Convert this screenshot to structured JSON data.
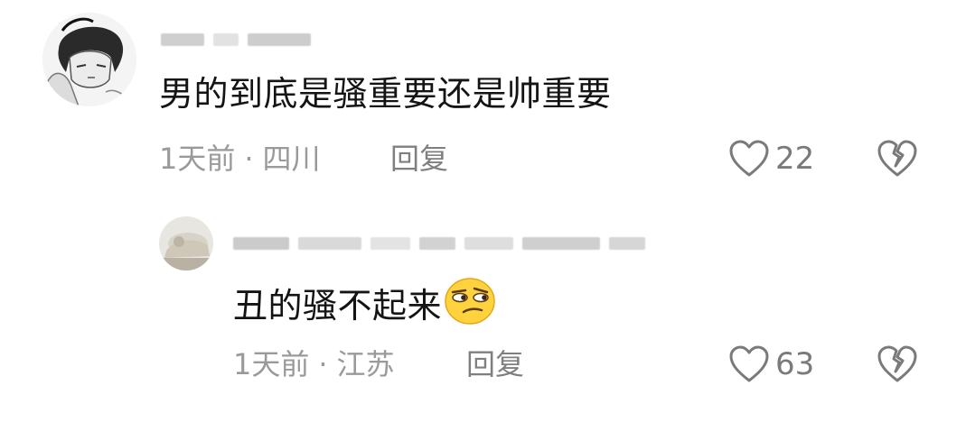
{
  "comments": [
    {
      "username": "",
      "text": "男的到底是骚重要还是帅重要",
      "time": "1天前",
      "separator": "·",
      "location": "四川",
      "reply_label": "回复",
      "likes": "22",
      "avatar_icon": "manga-character-avatar-icon"
    },
    {
      "username": "",
      "text": "丑的骚不起来",
      "emoji": "smirk-emoji-icon",
      "time": "1天前",
      "separator": "·",
      "location": "江苏",
      "reply_label": "回复",
      "likes": "63",
      "avatar_icon": "photo-avatar-icon"
    }
  ],
  "colors": {
    "text": "#141414",
    "meta": "#9a9a9a",
    "icon": "#7a7a7a",
    "emoji_face": "#ffd23e"
  }
}
